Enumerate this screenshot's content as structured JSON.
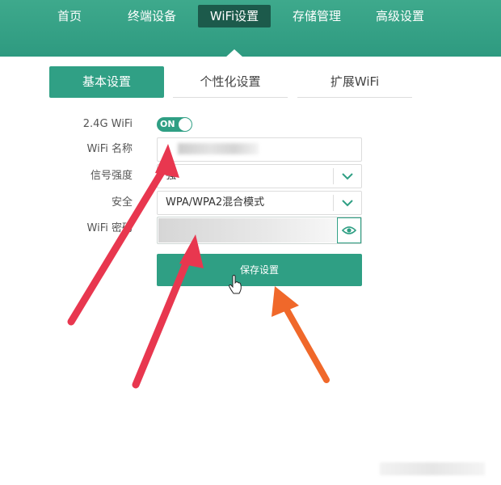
{
  "topnav": {
    "items": [
      {
        "label": "首页"
      },
      {
        "label": "终端设备"
      },
      {
        "label": "WiFi设置"
      },
      {
        "label": "存储管理"
      },
      {
        "label": "高级设置"
      }
    ],
    "active_index": 2
  },
  "subtabs": [
    {
      "label": "基本设置"
    },
    {
      "label": "个性化设置"
    },
    {
      "label": "扩展WiFi"
    }
  ],
  "form": {
    "wifi24": {
      "label": "2.4G WiFi",
      "toggle_text": "ON"
    },
    "name": {
      "label": "WiFi 名称"
    },
    "signal": {
      "label": "信号强度",
      "value": "强"
    },
    "security": {
      "label": "安全",
      "value": "WPA/WPA2混合模式"
    },
    "password": {
      "label": "WiFi 密码"
    }
  },
  "save_button": {
    "label": "保存设置"
  },
  "colors": {
    "brand": "#2f9f84",
    "nav_active": "#1c5a4b",
    "arrow_red": "#e8374f",
    "arrow_orange": "#f0682a"
  }
}
